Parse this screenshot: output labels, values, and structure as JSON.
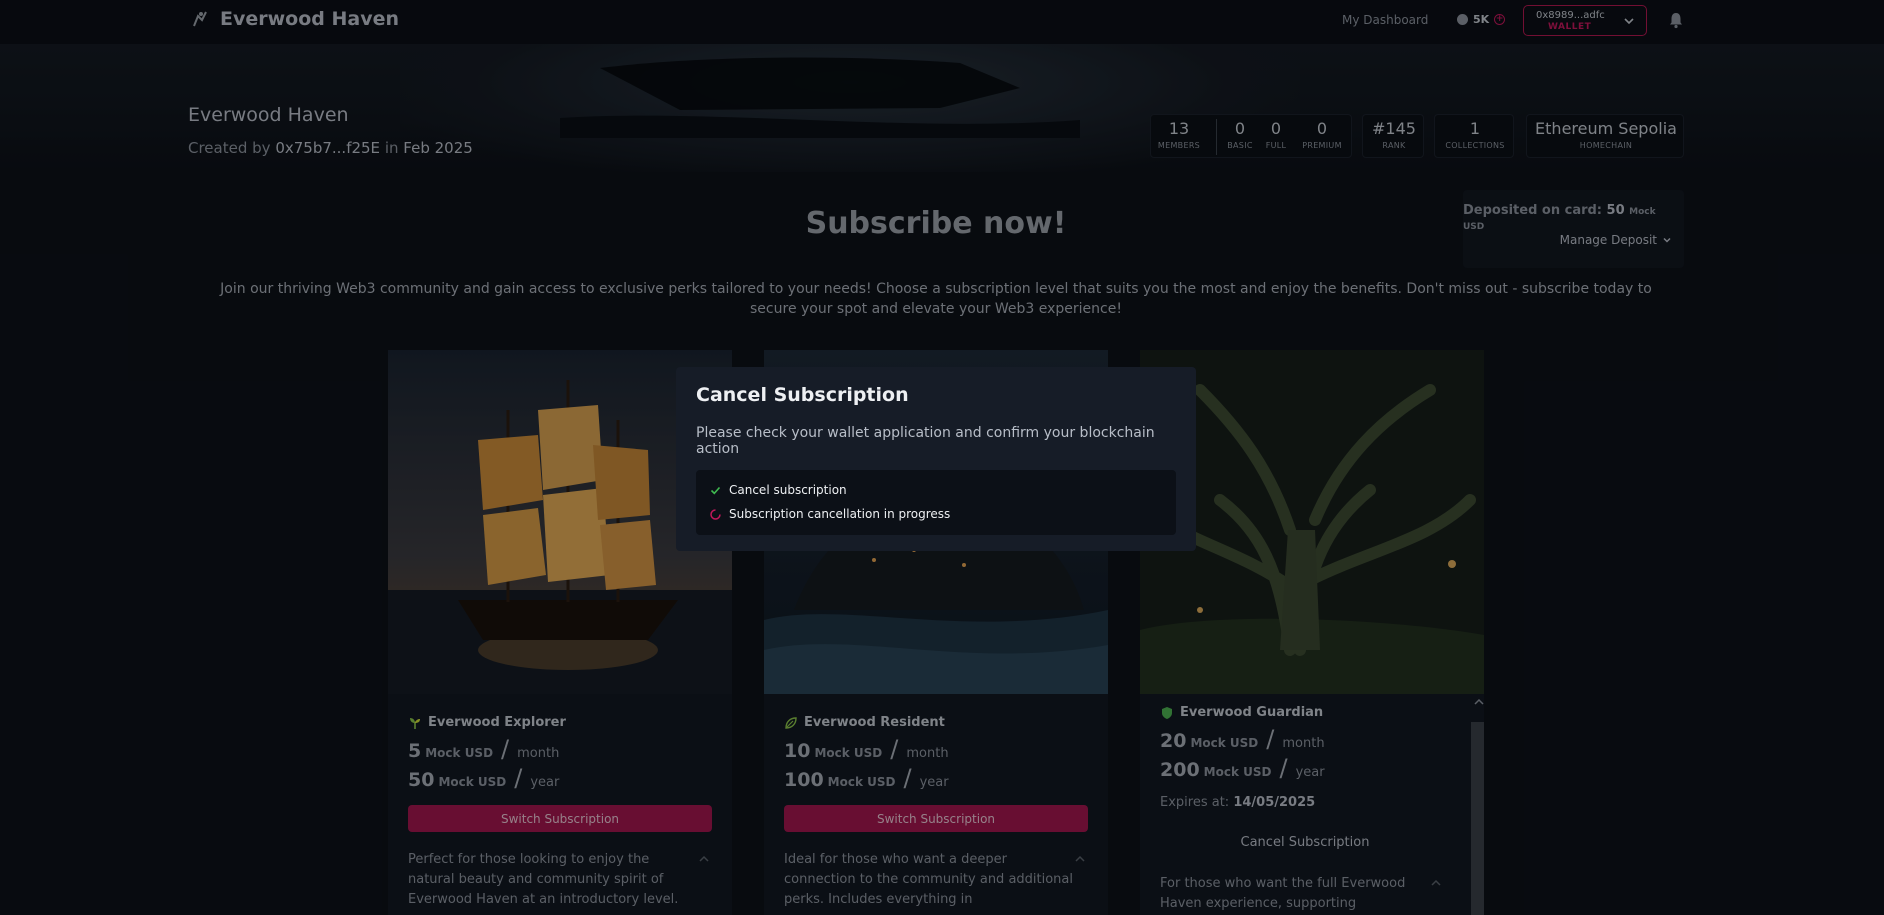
{
  "nav": {
    "brand": "Everwood Haven",
    "dashboard": "My Dashboard",
    "balance": "5K",
    "wallet_address": "0x8989...adfc",
    "wallet_label": "WALLET"
  },
  "hero": {
    "title": "Everwood Haven",
    "created_prefix": "Created by",
    "creator": "0x75b7...f25E",
    "created_in": "in",
    "created_date": "Feb 2025",
    "stats": {
      "members": {
        "value": "13",
        "label": "MEMBERS"
      },
      "basic": {
        "value": "0",
        "label": "BASIC"
      },
      "full": {
        "value": "0",
        "label": "FULL"
      },
      "premium": {
        "value": "0",
        "label": "PREMIUM"
      },
      "rank": {
        "value": "#145",
        "label": "RANK"
      },
      "collections": {
        "value": "1",
        "label": "COLLECTIONS"
      },
      "homechain": {
        "value": "Ethereum Sepolia",
        "label": "HOMECHAIN"
      }
    }
  },
  "main": {
    "title": "Subscribe now!",
    "intro": "Join our thriving Web3 community and gain access to exclusive perks tailored to your needs! Choose a subscription level that suits you the most and enjoy the benefits. Don't miss out - subscribe today to secure your spot and elevate your Web3 experience!",
    "deposit_label": "Deposited on card:",
    "deposit_value": "50",
    "deposit_unit": "Mock USD",
    "manage_deposit": "Manage Deposit"
  },
  "cards": [
    {
      "name": "Everwood Explorer",
      "month_amount": "5",
      "year_amount": "50",
      "currency": "Mock USD",
      "per_month": "month",
      "per_year": "year",
      "button": "Switch Subscription",
      "description": "Perfect for those looking to enjoy the natural beauty and community spirit of Everwood Haven at an introductory level."
    },
    {
      "name": "Everwood Resident",
      "month_amount": "10",
      "year_amount": "100",
      "currency": "Mock USD",
      "per_month": "month",
      "per_year": "year",
      "button": "Switch Subscription",
      "description": "Ideal for those who want a deeper connection to the community and additional perks. Includes everything in"
    },
    {
      "name": "Everwood Guardian",
      "month_amount": "20",
      "year_amount": "200",
      "currency": "Mock USD",
      "per_month": "month",
      "per_year": "year",
      "expires_label": "Expires at:",
      "expires_date": "14/05/2025",
      "cancel": "Cancel Subscription",
      "description": "For those who want the full Everwood Haven experience, supporting"
    }
  ],
  "modal": {
    "title": "Cancel Subscription",
    "subtitle": "Please check your wallet application and confirm your blockchain action",
    "steps": [
      {
        "label": "Cancel subscription",
        "state": "done"
      },
      {
        "label": "Subscription cancellation in progress",
        "state": "loading"
      }
    ]
  },
  "colors": {
    "accent": "#a0164e",
    "background": "#0d1118",
    "check": "#3fb950"
  }
}
